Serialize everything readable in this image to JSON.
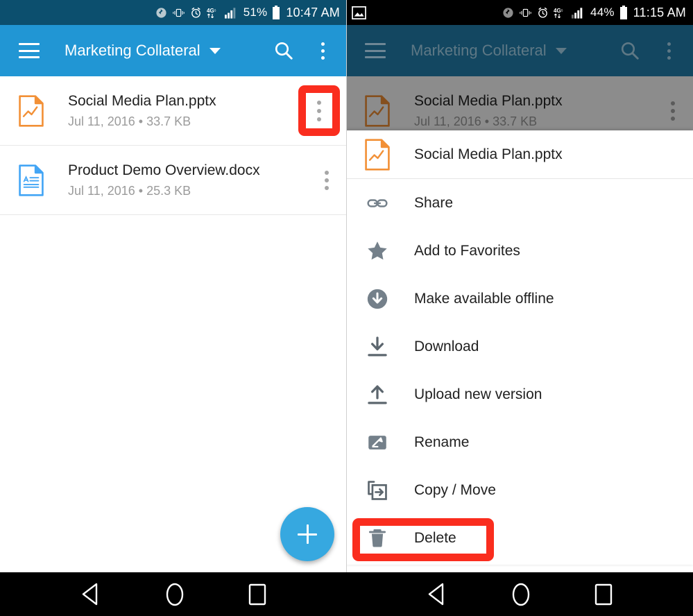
{
  "left_phone": {
    "status_bar": {
      "battery_pct": "51%",
      "time": "10:47 AM",
      "network": "4G",
      "icons": [
        "bluetooth-icon",
        "vibrate-icon",
        "alarm-icon",
        "4g-lte-icon",
        "signal-bars-icon",
        "battery-icon"
      ]
    },
    "app_bar": {
      "menu_icon": "hamburger-icon",
      "title": "Marketing Collateral",
      "caret_icon": "chevron-down-icon",
      "search_icon": "search-icon",
      "overflow_icon": "kebab-menu-icon"
    },
    "files": [
      {
        "icon": "pptx-file-icon",
        "icon_color": "#f29036",
        "name": "Social Media Plan.pptx",
        "date": "Jul 11, 2016",
        "separator": "•",
        "size": "33.7 KB",
        "overflow_icon": "kebab-menu-icon",
        "highlighted": true
      },
      {
        "icon": "docx-file-icon",
        "icon_color": "#42a5f5",
        "name": "Product Demo Overview.docx",
        "date": "Jul 11, 2016",
        "separator": "•",
        "size": "25.3 KB",
        "overflow_icon": "kebab-menu-icon",
        "highlighted": false
      }
    ],
    "fab": {
      "icon": "plus-icon",
      "label": "+",
      "color": "#36a8e0"
    }
  },
  "right_phone": {
    "status_bar": {
      "left_icon": "image-notification-icon",
      "battery_pct": "44%",
      "time": "11:15 AM",
      "network": "4G",
      "icons": [
        "bluetooth-icon",
        "vibrate-icon",
        "alarm-icon",
        "4g-lte-icon",
        "signal-bars-icon",
        "battery-icon"
      ]
    },
    "app_bar": {
      "menu_icon": "hamburger-icon",
      "title": "Marketing Collateral",
      "caret_icon": "chevron-down-icon",
      "search_icon": "search-icon",
      "overflow_icon": "kebab-menu-icon"
    },
    "dimmed_file": {
      "icon": "pptx-file-icon",
      "name": "Social Media Plan.pptx",
      "date": "Jul 11, 2016",
      "size": "33.7 KB"
    },
    "context_menu": {
      "header": {
        "icon": "pptx-file-icon",
        "label": "Social Media Plan.pptx"
      },
      "items": [
        {
          "icon": "link-icon",
          "label": "Share",
          "highlighted": false
        },
        {
          "icon": "star-icon",
          "label": "Add to Favorites",
          "highlighted": false
        },
        {
          "icon": "offline-icon",
          "label": "Make available offline",
          "highlighted": false
        },
        {
          "icon": "download-icon",
          "label": "Download",
          "highlighted": false
        },
        {
          "icon": "upload-icon",
          "label": "Upload new version",
          "highlighted": false
        },
        {
          "icon": "rename-icon",
          "label": "Rename",
          "highlighted": false
        },
        {
          "icon": "copy-move-icon",
          "label": "Copy / Move",
          "highlighted": false
        },
        {
          "icon": "trash-icon",
          "label": "Delete",
          "highlighted": true
        }
      ]
    }
  },
  "nav_bar": {
    "back_icon": "back-triangle-icon",
    "home_icon": "home-circle-icon",
    "recents_icon": "recents-square-icon"
  },
  "annotations": {
    "highlight_color": "#fa2d1e",
    "boxes": [
      "row-overflow-menu",
      "delete-menu-item"
    ]
  }
}
